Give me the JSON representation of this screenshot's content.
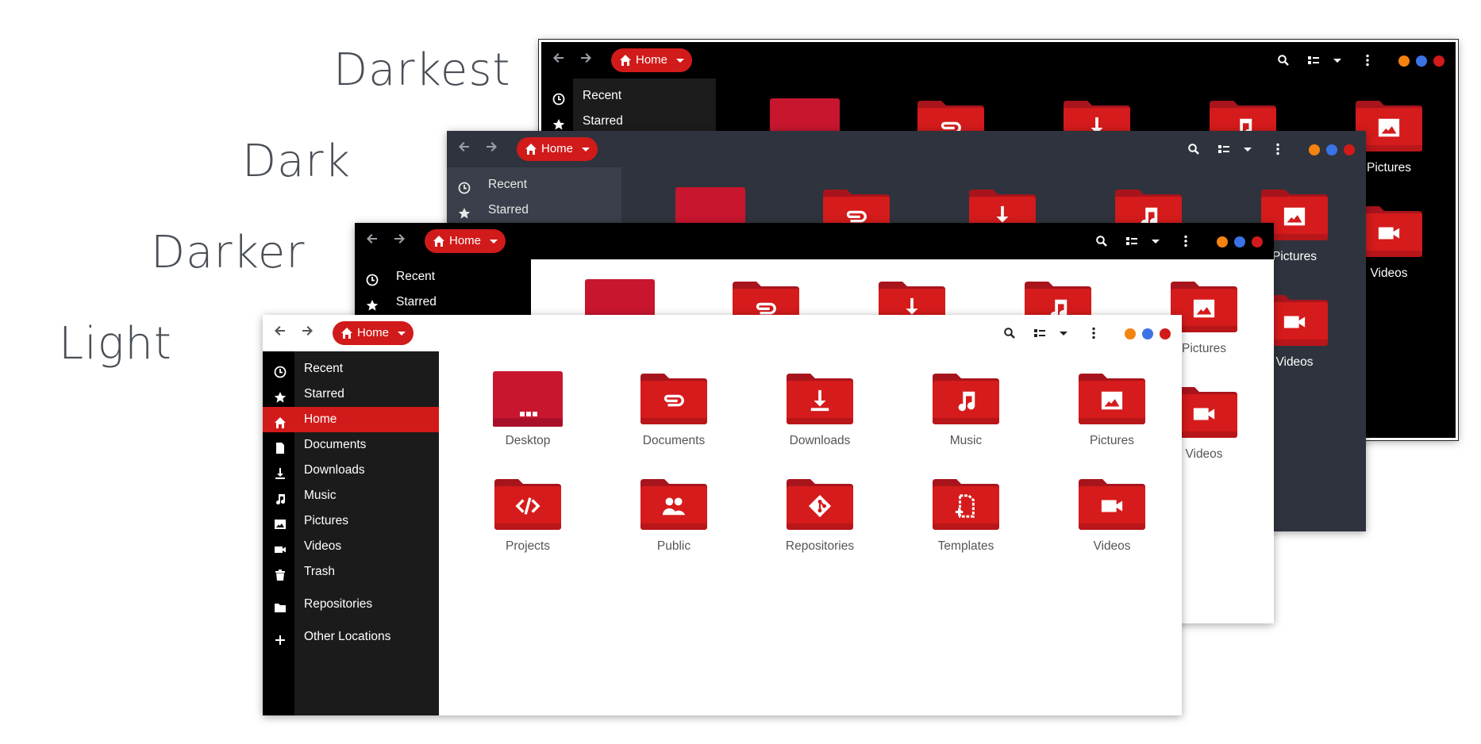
{
  "theme_labels": {
    "darkest": "Darkest",
    "dark": "Dark",
    "darker": "Darker",
    "light": "Light"
  },
  "colors": {
    "accent": "#d11a1a",
    "orange_dot": "#f5830f",
    "blue_dot": "#3b73e6",
    "red_dot": "#d11a1a"
  },
  "headerbar": {
    "path_label": "Home",
    "path_icon": "home-icon",
    "back_icon": "arrow-left-icon",
    "forward_icon": "arrow-right-icon",
    "search_icon": "search-icon",
    "view_icon": "list-view-icon",
    "menu_icon": "kebab-menu-icon"
  },
  "sidebar": {
    "items": [
      {
        "label": "Recent",
        "icon": "clock-icon"
      },
      {
        "label": "Starred",
        "icon": "star-icon"
      },
      {
        "label": "Home",
        "icon": "home-icon",
        "active": true
      },
      {
        "label": "Documents",
        "icon": "document-icon"
      },
      {
        "label": "Downloads",
        "icon": "download-icon"
      },
      {
        "label": "Music",
        "icon": "music-icon"
      },
      {
        "label": "Pictures",
        "icon": "image-icon"
      },
      {
        "label": "Videos",
        "icon": "video-icon"
      },
      {
        "label": "Trash",
        "icon": "trash-icon"
      },
      {
        "label": "Repositories",
        "icon": "folder-icon"
      },
      {
        "label": "Other Locations",
        "icon": "plus-icon"
      }
    ]
  },
  "folders": [
    {
      "label": "Desktop",
      "icon": "desktop-icon"
    },
    {
      "label": "Documents",
      "icon": "paperclip-icon"
    },
    {
      "label": "Downloads",
      "icon": "download-icon"
    },
    {
      "label": "Music",
      "icon": "music-icon"
    },
    {
      "label": "Pictures",
      "icon": "image-icon"
    },
    {
      "label": "Projects",
      "icon": "code-icon"
    },
    {
      "label": "Public",
      "icon": "people-icon"
    },
    {
      "label": "Repositories",
      "icon": "git-icon"
    },
    {
      "label": "Templates",
      "icon": "template-icon"
    },
    {
      "label": "Videos",
      "icon": "video-icon"
    }
  ]
}
